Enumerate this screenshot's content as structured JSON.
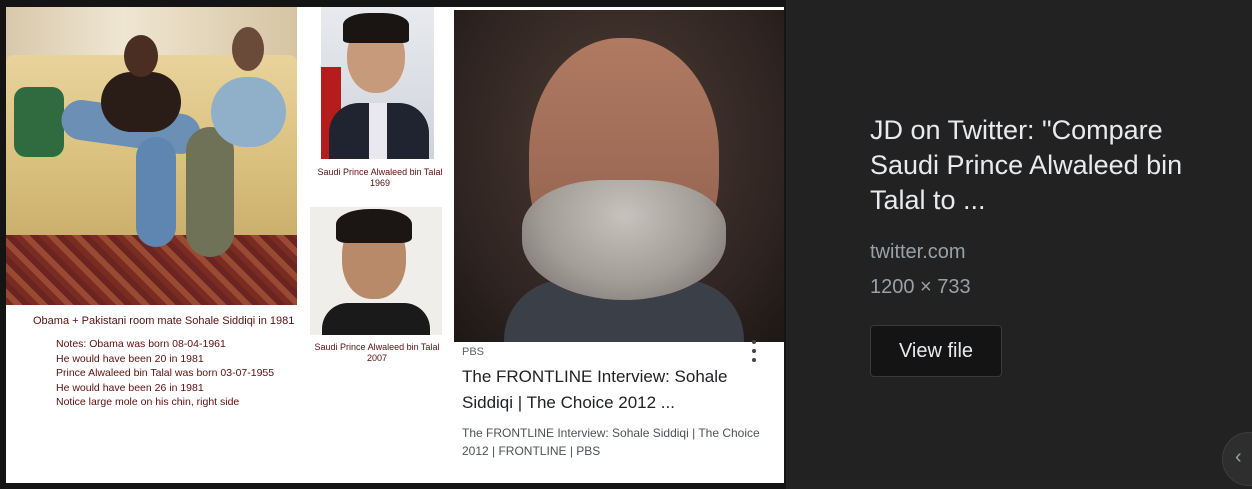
{
  "left_preview": {
    "collage": {
      "caption_prince_1969": [
        "Saudi Prince Alwaleed bin Talal",
        "1969"
      ],
      "caption_prince_2007": [
        "Saudi Prince Alwaleed bin Talal",
        "2007"
      ],
      "caption_obama": "Obama + Pakistani room mate Sohale Siddiqi in 1981",
      "notes": [
        "Notes: Obama was born 08-04-1961",
        "He would have been 20 in 1981",
        "Prince Alwaleed bin Talal was born 03-07-1955",
        "He would have been 26 in 1981",
        "Notice large mole on his chin, right side"
      ]
    },
    "result": {
      "source": "PBS",
      "title": "The FRONTLINE Interview: Sohale Siddiqi | The Choice 2012 ...",
      "snippet": "The FRONTLINE Interview: Sohale Siddiqi | The Choice 2012 | FRONTLINE | PBS",
      "more_icon": "more-vert-icon"
    }
  },
  "side_panel": {
    "title": "JD on Twitter: \"Compare Saudi Prince Alwaleed bin Talal to ...",
    "domain": "twitter.com",
    "dimensions": "1200 × 733",
    "view_button": "View file",
    "prev_icon": "chevron-left-icon"
  },
  "colors": {
    "page_bg": "#222222",
    "panel_bg": "#141414",
    "caption_text": "#5a0f0f",
    "side_title": "#e8eaed",
    "side_meta": "#9aa0a6"
  }
}
